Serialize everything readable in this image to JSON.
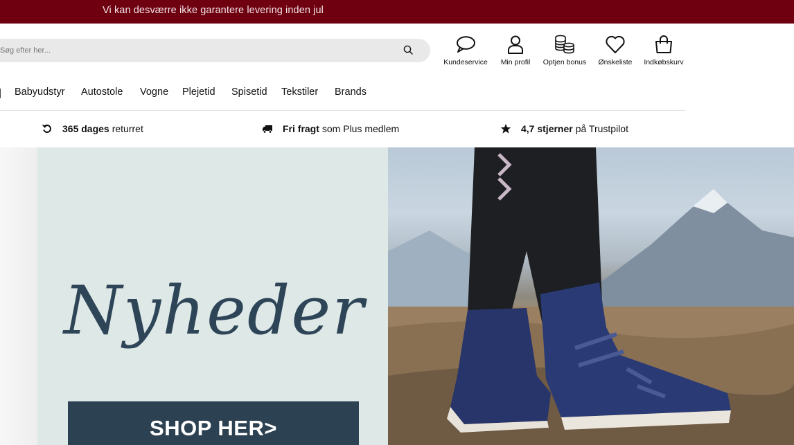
{
  "topbar": {
    "notice": "Vi kan desværre ikke garantere levering inden jul"
  },
  "search": {
    "placeholder": "Søg efter her..."
  },
  "header_icons": [
    {
      "icon": "chat-bubble-icon",
      "label": "Kundeservice"
    },
    {
      "icon": "user-icon",
      "label": "Min profil"
    },
    {
      "icon": "coins-icon",
      "label": "Optjen bonus"
    },
    {
      "icon": "heart-icon",
      "label": "Ønskeliste"
    },
    {
      "icon": "shopping-bag-icon",
      "label": "Indkøbskurv"
    }
  ],
  "nav": {
    "items": [
      "Babyudstyr",
      "Autostole",
      "Vogne",
      "Plejetid",
      "Spisetid",
      "Tekstiler",
      "Brands"
    ]
  },
  "usp": [
    {
      "icon": "return-icon",
      "bold": "365 dages",
      "text": "returret"
    },
    {
      "icon": "truck-icon",
      "bold": "Fri fragt",
      "text": "som Plus medlem"
    },
    {
      "icon": "star-icon",
      "bold": "4,7 stjerner",
      "text": "på Trustpilot"
    }
  ],
  "hero": {
    "headline": "Nyheder",
    "cta": "SHOP HER>"
  },
  "colors": {
    "topbar": "#6e0010",
    "cta": "#2c4152",
    "panel": "#dde8e7"
  }
}
